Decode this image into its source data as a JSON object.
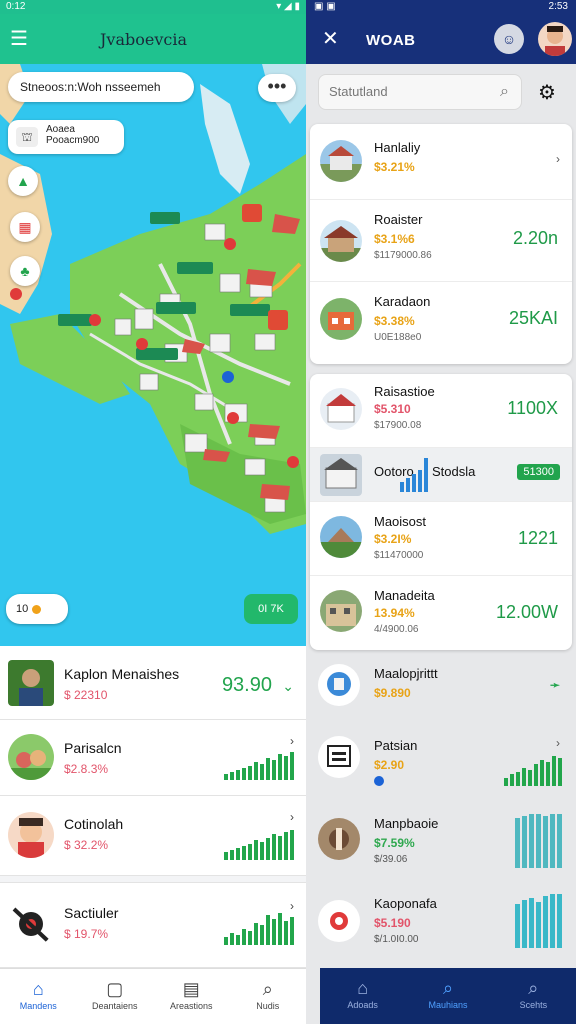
{
  "left": {
    "status": {
      "time": "0:12",
      "signal": "▾◢▮"
    },
    "header": {
      "title": "Jvaboevcia"
    },
    "map": {
      "search_text": "Stneoos:n:Woh nsseemeh",
      "chip_text_line1": "Aoaea",
      "chip_text_line2": "Pooacm900",
      "zoom_label": "10",
      "go_label": "0I 7K"
    },
    "list": [
      {
        "name": "Kaplon Menaishes",
        "price": "$ 22310",
        "value": "93.90"
      },
      {
        "name": "Parisalcn",
        "price": "$2.8.3%"
      },
      {
        "name": "Cotinolah",
        "price": "$ 32.2%"
      },
      {
        "name": "Sactiuler",
        "price": "$ 19.7%"
      }
    ],
    "nav": [
      "Mandens",
      "Deantaiens",
      "Areastions",
      "Nudis"
    ]
  },
  "right": {
    "status": {
      "time": "2:53"
    },
    "header": {
      "title": "WOAB"
    },
    "search_placeholder": "Statutland",
    "card1": [
      {
        "name": "Hanlaliy",
        "price": "$3.21%",
        "sub": "",
        "value": ""
      },
      {
        "name": "Roaister",
        "price": "$3.1%6",
        "sub": "$1179000.86",
        "value": "2.20n"
      },
      {
        "name": "Karadaon",
        "price": "$3.38%",
        "sub": "U0E188e0",
        "value": "25KAI"
      }
    ],
    "card2": [
      {
        "name": "Raisastioe",
        "price": "$5.310",
        "sub": "$17900.08",
        "value": "1100X"
      },
      {
        "name": "Ootoro",
        "name2": "Stodsla",
        "badge": "51300"
      },
      {
        "name": "Maoisost",
        "price": "$3.2I%",
        "sub": "$11470000",
        "value": "1221"
      },
      {
        "name": "Manadeita",
        "price": "13.94%",
        "sub": "4/4900.06",
        "value": "12.00W"
      }
    ],
    "plain": [
      {
        "name": "Maalopjrittt",
        "price": "$9.890"
      },
      {
        "name": "Patsian",
        "price": "$2.90"
      },
      {
        "name": "Manpbaoie",
        "price": "$7.59%",
        "sub": "$/39.06"
      },
      {
        "name": "Kaoponafa",
        "price": "$5.190",
        "sub": "$/1.0I0.00"
      }
    ],
    "nav": [
      "Adoads",
      "Mauhians",
      "Scehts"
    ]
  },
  "colors": {
    "green": "#22a44d",
    "teal": "#1fc28f",
    "navy": "#17307a",
    "pink": "#e2546a",
    "gold": "#e8a317"
  }
}
